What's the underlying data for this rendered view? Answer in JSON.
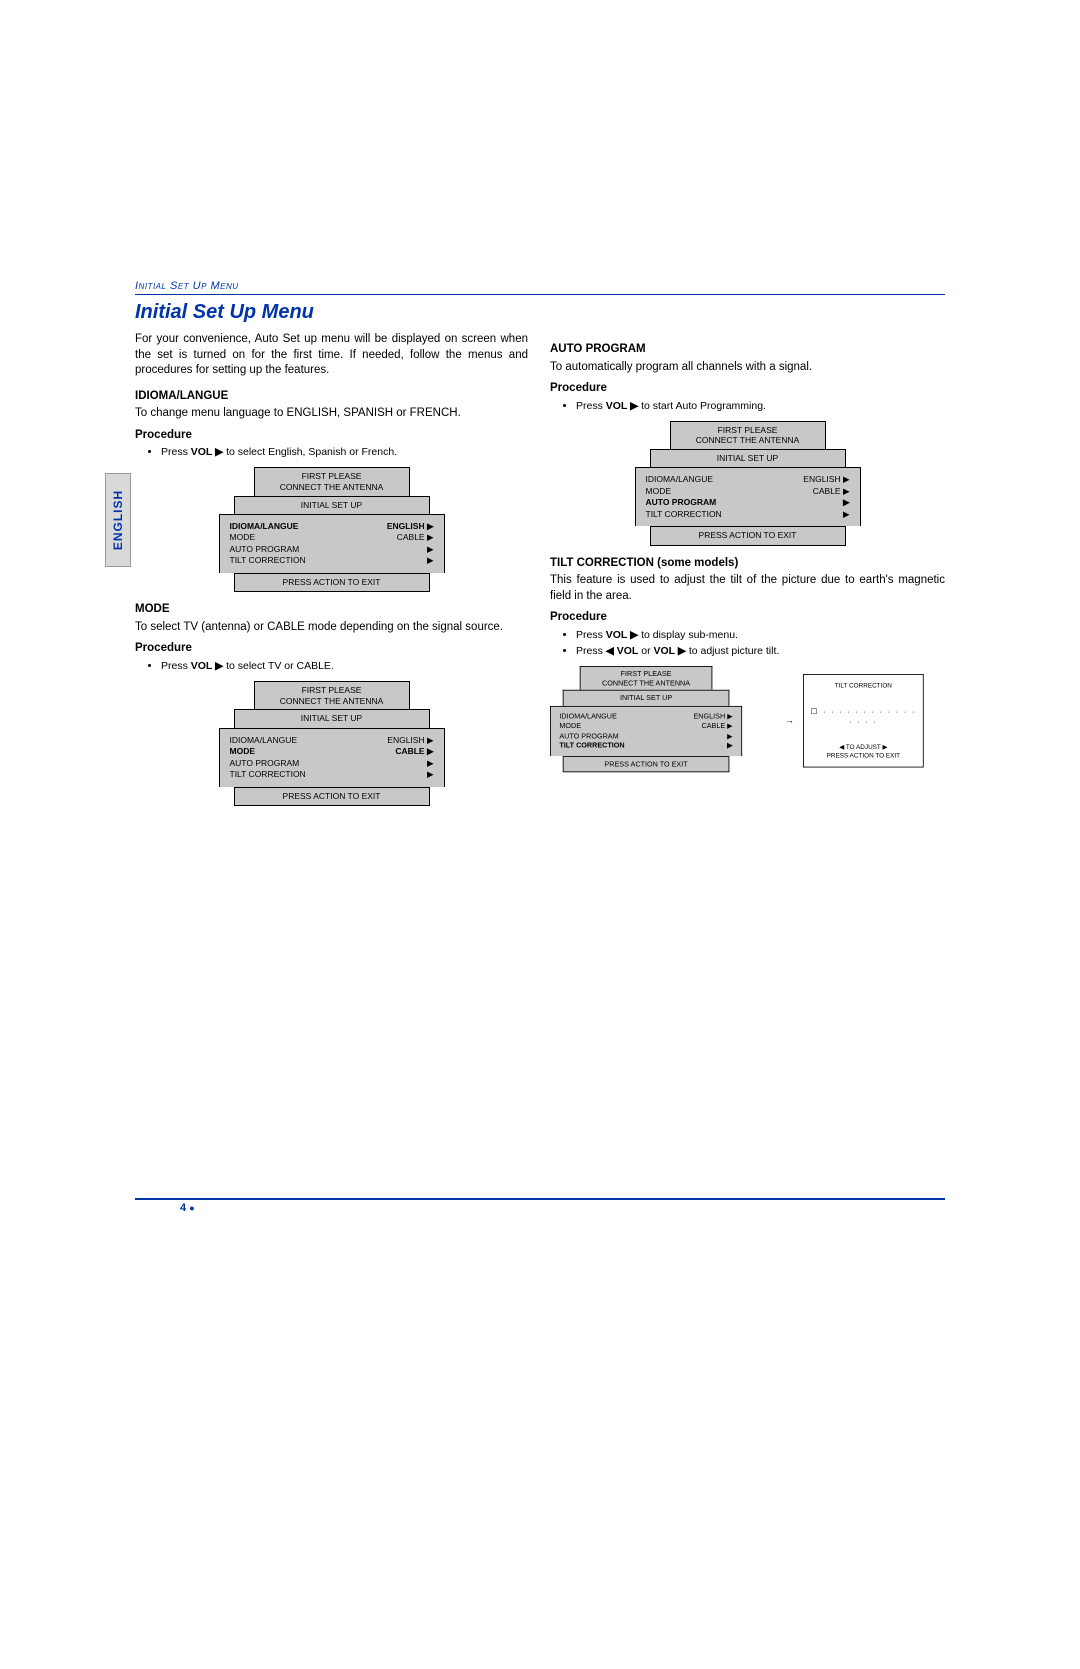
{
  "header": {
    "breadcrumb": "Initial Set Up Menu",
    "title": "Initial Set Up Menu"
  },
  "sideTab": "ENGLISH",
  "pageNumber": "4",
  "intro": "For your convenience, Auto Set up menu will be displayed on screen when the set is turned on for the first time. If needed, follow the menus and procedures for setting up the features.",
  "sections": {
    "idioma": {
      "heading": "IDIOMA/LANGUE",
      "body": "To change menu language to ENGLISH, SPANISH or FRENCH.",
      "procLabel": "Procedure",
      "bullet_pre": "Press ",
      "bullet_bold": "VOL ▶",
      "bullet_post": " to select English, Spanish or French."
    },
    "mode": {
      "heading": "MODE",
      "body": "To select TV (antenna) or CABLE mode depending on the signal source.",
      "procLabel": "Procedure",
      "bullet_pre": "Press ",
      "bullet_bold": "VOL ▶",
      "bullet_post": " to select TV or CABLE."
    },
    "auto": {
      "heading": "AUTO PROGRAM",
      "body": "To automatically program all channels with a signal.",
      "procLabel": "Procedure",
      "bullet_pre": "Press ",
      "bullet_bold": "VOL ▶",
      "bullet_post": " to start Auto Programming."
    },
    "tilt": {
      "heading": "TILT CORRECTION (some models)",
      "body": "This feature is used to adjust the tilt of the picture due to earth's magnetic field in the area.",
      "procLabel": "Procedure",
      "b1_pre": "Press ",
      "b1_bold": "VOL ▶",
      "b1_post": "  to display sub-menu.",
      "b2_pre": "Press ",
      "b2_bold1": "◀ VOL",
      "b2_mid": " or ",
      "b2_bold2": "VOL ▶",
      "b2_post": " to adjust picture tilt."
    }
  },
  "osd": {
    "topLine1": "FIRST PLEASE",
    "topLine2": "CONNECT THE ANTENNA",
    "mid": "INITIAL SET UP",
    "rows": {
      "idioma": {
        "l": "IDIOMA/LANGUE",
        "r": "ENGLISH ▶"
      },
      "mode": {
        "l": "MODE",
        "r": "CABLE ▶"
      },
      "auto": {
        "l": "AUTO PROGRAM",
        "r": "▶"
      },
      "tilt": {
        "l": "TILT CORRECTION",
        "r": "▶"
      }
    },
    "bottom": "PRESS ACTION TO EXIT"
  },
  "tiltBox": {
    "title": "TILT CORRECTION",
    "dotsPrefix": "☐",
    "adjust": "◀    TO ADJUST    ▶",
    "exit": "PRESS ACTION TO EXIT"
  }
}
